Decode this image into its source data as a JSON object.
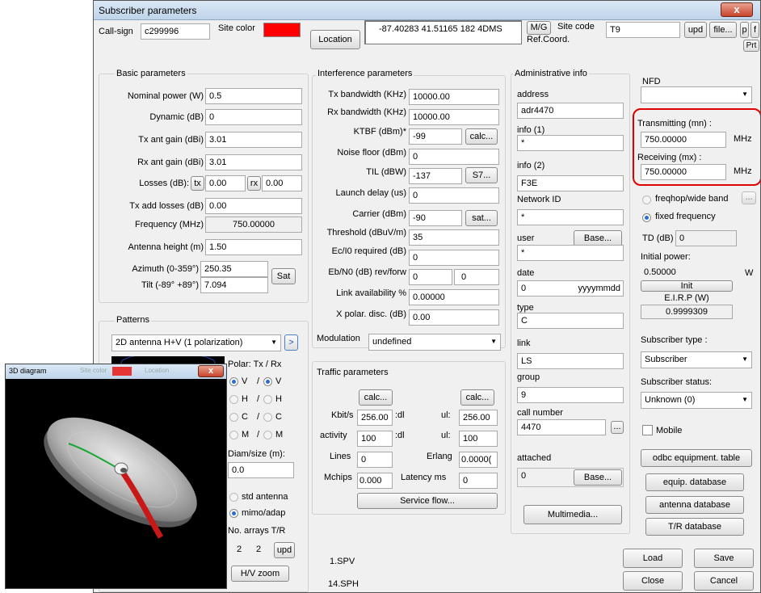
{
  "window": {
    "title": "Subscriber parameters",
    "close": "x"
  },
  "top": {
    "callsign_label": "Call-sign",
    "callsign": "c299996",
    "site_color_label": "Site color",
    "site_color": "#ff0000",
    "location_btn": "Location",
    "location_value": "-87.40283 41.51165 182 4DMS",
    "mg_btn": "M/G",
    "ref_coord": "Ref.Coord.",
    "site_code_label": "Site code",
    "site_code": "T9",
    "upd_btn": "upd",
    "file_btn": "file...",
    "p_btn": "p",
    "f_btn": "f",
    "prt_btn": "Prt"
  },
  "basic": {
    "title": "Basic parameters",
    "nominal_power_label": "Nominal power (W)",
    "nominal_power": "0.5",
    "dynamic_label": "Dynamic (dB)",
    "dynamic": "0",
    "tx_gain_label": "Tx ant gain (dBi)",
    "tx_gain": "3.01",
    "rx_gain_label": "Rx ant gain (dBi)",
    "rx_gain": "3.01",
    "losses_label": "Losses (dB):",
    "tx_btn": "tx",
    "tx_loss": "0.00",
    "rx_btn": "rx",
    "rx_loss": "0.00",
    "tx_add_label": "Tx add losses (dB)",
    "tx_add": "0.00",
    "freq_label": "Frequency (MHz)",
    "freq": "750.00000",
    "ant_height_label": "Antenna height (m)",
    "ant_height": "1.50",
    "azimuth_label": "Azimuth (0-359°)",
    "azimuth": "250.35",
    "tilt_label": "Tilt (-89° +89°)",
    "tilt": "7.094",
    "sat_btn": "Sat"
  },
  "patterns": {
    "title": "Patterns",
    "select": "2D antenna H+V (1 polarization)",
    "go_btn": ">",
    "polar_label": "Polar: Tx / Rx",
    "pol_rows": [
      {
        "a": "V",
        "b": "/",
        "c": "V"
      },
      {
        "a": "H",
        "b": "/",
        "c": "H"
      },
      {
        "a": "C",
        "b": "/",
        "c": "C"
      },
      {
        "a": "M",
        "b": "/",
        "c": "M"
      }
    ],
    "diam_label": "Diam/size (m):",
    "diam": "0.0",
    "std_antenna": "std antenna",
    "mimo": "mimo/adap",
    "arrays_label": "No. arrays T/R",
    "arrays_t": "2",
    "arrays_r": "2",
    "upd_btn": "upd",
    "hv_zoom_btn": "H/V zoom"
  },
  "interference": {
    "title": "Interference parameters",
    "tx_bw_label": "Tx bandwidth (KHz)",
    "tx_bw": "10000.00",
    "rx_bw_label": "Rx bandwidth (KHz)",
    "rx_bw": "10000.00",
    "ktbf_label": "KTBF (dBm)*",
    "ktbf": "-99",
    "calc_btn": "calc...",
    "noise_label": "Noise floor (dBm)",
    "noise": "0",
    "til_label": "TIL (dBW)",
    "til": "-137",
    "s7_btn": "S7...",
    "launch_label": "Launch delay (us)",
    "launch": "0",
    "carrier_label": "Carrier (dBm)",
    "carrier": "-90",
    "sat_btn": "sat...",
    "threshold_label": "Threshold (dBuV/m)",
    "threshold": "35",
    "ec_label": "Ec/I0 required (dB)",
    "ec": "0",
    "eb_label": "Eb/N0 (dB) rev/forw",
    "eb_rev": "0",
    "eb_fwd": "0",
    "link_label": "Link availability %",
    "link": "0.00000",
    "xpol_label": "X polar. disc. (dB)",
    "xpol": "0.00",
    "modulation_label": "Modulation",
    "modulation": "undefined"
  },
  "traffic": {
    "title": "Traffic parameters",
    "calc_btn": "calc...",
    "kbits_label": "Kbit/s",
    "kbits_dl": "256.00",
    "dl": ":dl",
    "ul": "ul:",
    "kbits_ul": "256.00",
    "activity_label": "activity",
    "activity_dl": "100",
    "activity_ul": "100",
    "lines_label": "Lines",
    "lines": "0",
    "erlang_label": "Erlang",
    "erlang": "0.0000(",
    "mchips_label": "Mchips",
    "mchips": "0.000",
    "latency_label": "Latency ms",
    "latency": "0",
    "service_btn": "Service flow..."
  },
  "bottom": {
    "spv": "1.SPV",
    "sph": "14.SPH"
  },
  "admin": {
    "title": "Administrative info",
    "address_label": "address",
    "address": "adr4470",
    "info1_label": "info (1)",
    "info1": "*",
    "info2_label": "info (2)",
    "info2": "F3E",
    "network_label": "Network ID",
    "network": "*",
    "user_label": "user",
    "base_btn": "Base...",
    "user": "*",
    "date_label": "date",
    "date": "0",
    "date_fmt": "yyyymmdd",
    "type_label": "type",
    "type": "C",
    "link_label": "link",
    "link": "LS",
    "group_label": "group",
    "group": "9",
    "call_label": "call number",
    "call": "4470",
    "dots_btn": "...",
    "attached_label": "attached",
    "attached": "0",
    "base2_btn": "Base...",
    "multimedia_btn": "Multimedia..."
  },
  "right": {
    "nfd_label": "NFD",
    "nfd": "",
    "tx_label": "Transmitting (mn) :",
    "tx": "750.00000",
    "tx_unit": "MHz",
    "rx_label": "Receiving (mx) :",
    "rx": "750.00000",
    "rx_unit": "MHz",
    "highlight": "#e00000",
    "freqhop": "freqhop/wide band",
    "freqhop_btn": "...",
    "fixed": "fixed frequency",
    "td_label": "TD (dB)",
    "td": "0",
    "init_power_label": "Initial power:",
    "init_power": "0.50000",
    "w": "W",
    "init_btn": "Init",
    "eirp_label": "E.I.R.P (W)",
    "eirp": "0.9999309",
    "sub_type_label": "Subscriber type :",
    "sub_type": "Subscriber",
    "sub_status_label": "Subscriber status:",
    "sub_status": "Unknown (0)",
    "mobile": "Mobile",
    "odbc_btn": "odbc equipment. table",
    "equip_btn": "equip. database",
    "antenna_btn": "antenna database",
    "tr_btn": "T/R database",
    "load_btn": "Load",
    "save_btn": "Save",
    "close_btn": "Close",
    "cancel_btn": "Cancel"
  },
  "diagram": {
    "title": "3D diagram",
    "close": "x",
    "ghost1": "Site color",
    "ghost2": "Location"
  }
}
